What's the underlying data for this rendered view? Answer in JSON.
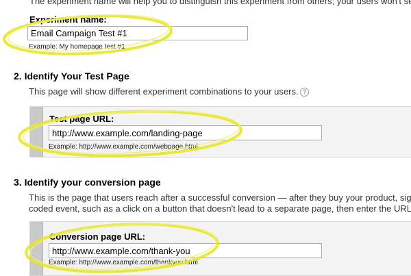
{
  "intro": {
    "text": "The experiment name will help you to distinguish this experiment from others; your users won't se"
  },
  "experiment_name": {
    "label": "Experiment name:",
    "value": "Email Campaign Test #1",
    "example": "Example: My homepage test #1"
  },
  "step2": {
    "heading": "2. Identify Your Test Page",
    "description": "This page will show different experiment combinations to your users.",
    "help_icon": "question-mark-icon",
    "field_label": "Test page URL:",
    "field_value": "http://www.example.com/landing-page",
    "example": "Example: http://www.example.com/webpage.html"
  },
  "step3": {
    "heading": "3. Identify your conversion page",
    "description_line1": "This is the page that users reach after a successful conversion — after they buy your product, sig",
    "description_line2": "coded event, such as a click on a button that doesn't lead to a separate page, then enter the URL",
    "field_label": "Conversion page URL:",
    "field_value": "http://www.example.com/thank-you",
    "example": "Example: http://www.example.com/thankyou.html"
  },
  "colors": {
    "highlight": "#e6e629",
    "panel_bg": "#f3f3f3",
    "panel_bar": "#c9c9c9"
  }
}
